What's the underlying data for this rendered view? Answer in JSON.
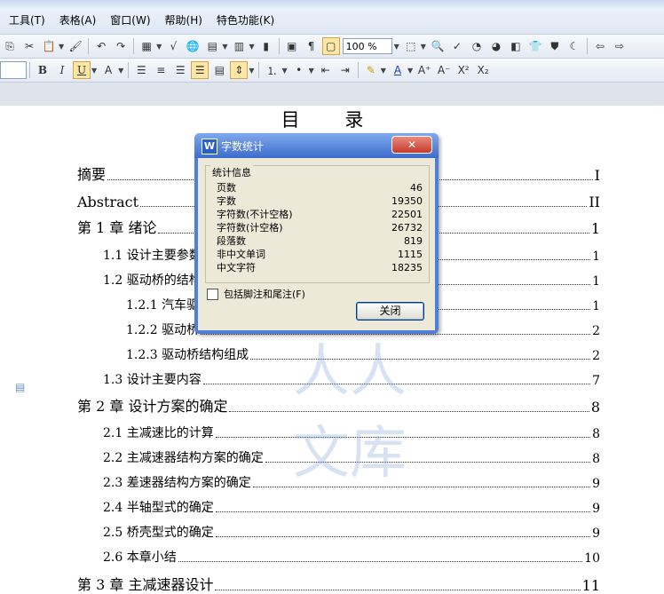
{
  "menu": [
    "工具(T)",
    "表格(A)",
    "窗口(W)",
    "帮助(H)",
    "特色功能(K)"
  ],
  "toolbar": {
    "zoom": "100 %",
    "bold": "B",
    "italic": "I",
    "underline": "U",
    "superscript": "X²",
    "subscript": "X₂"
  },
  "document": {
    "title": "目 录",
    "toc": [
      {
        "text": "摘要",
        "page": "I",
        "level": 1
      },
      {
        "text": "Abstract",
        "page": "II",
        "level": 1
      },
      {
        "text": "第 1 章  绪论",
        "page": "1",
        "level": 1
      },
      {
        "text": "1.1  设计主要参数",
        "page": "1",
        "level": 2
      },
      {
        "text": "1.2  驱动桥的结构",
        "page": "1",
        "level": 2
      },
      {
        "text": "1.2.1  汽车驱动桥",
        "page": "1",
        "level": 3
      },
      {
        "text": "1.2.2  驱动桥",
        "page": "2",
        "level": 3
      },
      {
        "text": "1.2.3  驱动桥结构组成",
        "page": "2",
        "level": 3
      },
      {
        "text": "1.3  设计主要内容",
        "page": "7",
        "level": 2
      },
      {
        "text": "第 2 章  设计方案的确定",
        "page": "8",
        "level": 1
      },
      {
        "text": "2.1  主减速比的计算",
        "page": "8",
        "level": 2
      },
      {
        "text": "2.2  主减速器结构方案的确定",
        "page": "8",
        "level": 2
      },
      {
        "text": "2.3  差速器结构方案的确定",
        "page": "9",
        "level": 2
      },
      {
        "text": "2.4  半轴型式的确定",
        "page": "9",
        "level": 2
      },
      {
        "text": "2.5  桥壳型式的确定",
        "page": "9",
        "level": 2
      },
      {
        "text": "2.6  本章小结",
        "page": "10",
        "level": 2
      },
      {
        "text": "第 3 章  主减速器设计",
        "page": "11",
        "level": 1
      }
    ]
  },
  "watermark": "人人文库",
  "dialog": {
    "title": "字数统计",
    "close_icon": "close-icon",
    "group_label": "统计信息",
    "stats": [
      {
        "label": "页数",
        "value": "46"
      },
      {
        "label": "字数",
        "value": "19350"
      },
      {
        "label": "字符数(不计空格)",
        "value": "22501"
      },
      {
        "label": "字符数(计空格)",
        "value": "26732"
      },
      {
        "label": "段落数",
        "value": "819"
      },
      {
        "label": "非中文单词",
        "value": "1115"
      },
      {
        "label": "中文字符",
        "value": "18235"
      }
    ],
    "checkbox_label": "包括脚注和尾注(F)",
    "checkbox_checked": false,
    "close_button": "关闭"
  }
}
